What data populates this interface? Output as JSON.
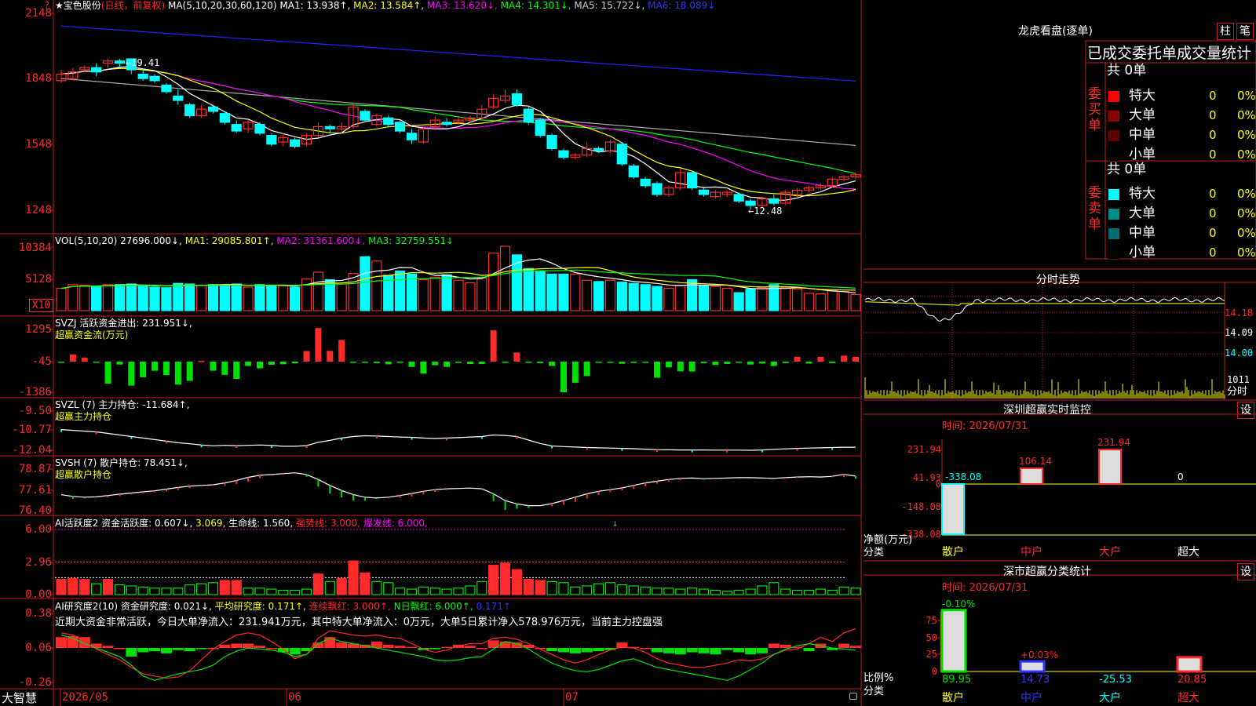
{
  "colors": {
    "up": "#ff2a2a",
    "down": "#00ffff",
    "grid": "#c81e1e",
    "ma1": "#ffffff",
    "ma2": "#ffff00",
    "ma3": "#ff00ff",
    "ma4": "#00ff00",
    "ma5": "#aaaaaa",
    "ma6": "#2323ff",
    "green": "#00e000",
    "yellow": "#ffff00",
    "magenta": "#ff00ff"
  },
  "price_panel": {
    "title": "★宝色股份",
    "period": "(日线，前复权)",
    "ma_prefix": "MA(5,10,20,30,60,120)",
    "mas": [
      {
        "label": "MA1: 13.938↑,",
        "key": "ma1"
      },
      {
        "label": "MA2: 13.584↑,",
        "key": "ma2"
      },
      {
        "label": "MA3: 13.620↓,",
        "key": "ma3"
      },
      {
        "label": "MA4: 14.301↓,",
        "key": "ma4"
      },
      {
        "label": "MA5: 15.722↓,",
        "key": "ma5"
      },
      {
        "label": "MA6: 18.089↓",
        "key": "ma6"
      }
    ],
    "y_labels": [
      "2148",
      "1848",
      "1548",
      "1248"
    ],
    "high_note": "←19.41",
    "low_note": "←12.48",
    "question_mark": "?"
  },
  "candles": [
    [
      18.4,
      18.7,
      18.3,
      18.9
    ],
    [
      18.5,
      18.8,
      18.4,
      19.0
    ],
    [
      18.9,
      19.0,
      18.8,
      19.1
    ],
    [
      19.0,
      18.8,
      18.6,
      19.2
    ],
    [
      19.2,
      19.3,
      19.0,
      19.4
    ],
    [
      19.3,
      19.2,
      19.0,
      19.4
    ],
    [
      19.4,
      18.9,
      18.7,
      19.41
    ],
    [
      18.7,
      18.5,
      18.4,
      18.9
    ],
    [
      18.6,
      18.4,
      18.3,
      18.7
    ],
    [
      18.2,
      17.9,
      17.8,
      18.3
    ],
    [
      17.7,
      17.5,
      17.3,
      18.0
    ],
    [
      17.3,
      16.8,
      16.7,
      17.4
    ],
    [
      16.8,
      17.1,
      16.7,
      17.3
    ],
    [
      17.2,
      17.0,
      16.9,
      17.3
    ],
    [
      16.9,
      16.5,
      16.4,
      17.0
    ],
    [
      16.4,
      16.1,
      16.0,
      16.6
    ],
    [
      16.2,
      16.5,
      16.0,
      16.6
    ],
    [
      16.4,
      16.0,
      15.9,
      16.5
    ],
    [
      15.9,
      15.5,
      15.4,
      16.0
    ],
    [
      15.6,
      15.8,
      15.4,
      16.0
    ],
    [
      15.7,
      15.4,
      15.3,
      15.8
    ],
    [
      15.5,
      15.9,
      15.4,
      16.0
    ],
    [
      15.9,
      16.3,
      15.8,
      16.5
    ],
    [
      16.3,
      16.2,
      16.0,
      16.4
    ],
    [
      16.2,
      16.3,
      16.0,
      16.5
    ],
    [
      16.3,
      17.2,
      16.2,
      17.3
    ],
    [
      17.0,
      16.6,
      16.5,
      17.1
    ],
    [
      16.4,
      16.8,
      16.3,
      16.9
    ],
    [
      16.7,
      16.4,
      16.3,
      16.8
    ],
    [
      16.5,
      16.1,
      16.0,
      16.6
    ],
    [
      16.0,
      15.7,
      15.5,
      16.2
    ],
    [
      15.6,
      16.2,
      15.5,
      16.3
    ],
    [
      16.3,
      16.6,
      16.2,
      16.8
    ],
    [
      16.5,
      16.4,
      16.3,
      16.7
    ],
    [
      16.5,
      16.6,
      16.4,
      16.8
    ],
    [
      16.6,
      16.7,
      16.5,
      16.8
    ],
    [
      16.7,
      17.1,
      16.6,
      17.3
    ],
    [
      17.2,
      17.6,
      17.1,
      17.8
    ],
    [
      17.5,
      17.7,
      17.4,
      18.0
    ],
    [
      17.8,
      17.3,
      17.2,
      18.0
    ],
    [
      17.1,
      16.5,
      16.4,
      17.2
    ],
    [
      16.6,
      15.9,
      15.8,
      16.7
    ],
    [
      15.9,
      15.3,
      15.2,
      16.0
    ],
    [
      15.2,
      14.9,
      14.8,
      15.3
    ],
    [
      14.9,
      15.0,
      14.8,
      15.1
    ],
    [
      15.0,
      15.3,
      14.9,
      15.6
    ],
    [
      15.3,
      15.2,
      15.1,
      15.4
    ],
    [
      15.2,
      15.6,
      15.1,
      15.7
    ],
    [
      15.5,
      14.6,
      14.5,
      15.6
    ],
    [
      14.5,
      14.0,
      13.9,
      14.6
    ],
    [
      13.9,
      13.6,
      13.5,
      14.0
    ],
    [
      13.7,
      13.2,
      13.1,
      13.8
    ],
    [
      13.2,
      13.5,
      13.1,
      13.6
    ],
    [
      13.5,
      14.2,
      13.4,
      14.4
    ],
    [
      14.2,
      13.5,
      13.4,
      14.3
    ],
    [
      13.4,
      13.2,
      13.1,
      13.5
    ],
    [
      13.1,
      13.3,
      13.0,
      13.4
    ],
    [
      13.2,
      13.3,
      13.1,
      13.4
    ],
    [
      13.2,
      12.9,
      12.8,
      13.3
    ],
    [
      12.9,
      12.7,
      12.5,
      13.0
    ],
    [
      12.7,
      13.0,
      12.6,
      13.1
    ],
    [
      13.0,
      12.8,
      12.7,
      13.2
    ],
    [
      12.8,
      13.3,
      12.7,
      13.4
    ],
    [
      13.2,
      13.4,
      13.1,
      13.5
    ],
    [
      13.4,
      13.5,
      13.3,
      13.6
    ],
    [
      13.5,
      13.6,
      13.4,
      13.7
    ],
    [
      13.6,
      13.9,
      13.5,
      14.0
    ],
    [
      13.9,
      14.0,
      13.8,
      14.1
    ],
    [
      14.0,
      14.1,
      13.9,
      14.2
    ]
  ],
  "vol_panel": {
    "label": "VOL(5,10,20)",
    "value": "27696.000↓,",
    "ma1": "MA1: 29085.801↑,",
    "ma2": "MA2: 31361.600↓,",
    "ma3": "MA3: 32759.551↓",
    "y_labels": [
      "10384",
      "5128"
    ],
    "unit": "X10"
  },
  "volumes": [
    3600,
    4200,
    4100,
    4000,
    4200,
    4200,
    4300,
    4000,
    3800,
    3700,
    4400,
    4300,
    4100,
    4200,
    4100,
    4300,
    3800,
    4200,
    4000,
    4000,
    3800,
    5100,
    6200,
    5000,
    4300,
    6000,
    8700,
    8000,
    5700,
    6400,
    5900,
    5000,
    5400,
    5800,
    4900,
    4500,
    5300,
    9300,
    10384,
    9000,
    6800,
    6300,
    5900,
    5900,
    5900,
    4900,
    4700,
    4900,
    4600,
    4400,
    4200,
    3900,
    3600,
    4100,
    5000,
    4000,
    3900,
    3600,
    2900,
    3500,
    3700,
    4200,
    3700,
    3500,
    2800,
    2700,
    3200,
    3100,
    2600
  ],
  "svzj_panel": {
    "label": "SVZJ  活跃资金进出: 231.951↓,",
    "sub": "超赢资金流(万元)",
    "y_labels": [
      "1295",
      "-45",
      "-1386"
    ]
  },
  "svzj_bars": [
    -40,
    300,
    160,
    -30,
    -920,
    -120,
    -1000,
    -650,
    -380,
    -560,
    -960,
    -800,
    30,
    -380,
    -550,
    -720,
    -180,
    -280,
    -130,
    -110,
    -70,
    440,
    1400,
    450,
    900,
    -30,
    -20,
    -60,
    -110,
    -50,
    -220,
    -500,
    -150,
    -220,
    -50,
    -100,
    -100,
    1300,
    -10,
    380,
    -30,
    -60,
    -180,
    -1280,
    -880,
    -600,
    -40,
    -30,
    -90,
    -20,
    -10,
    -670,
    -240,
    -400,
    -410,
    -60,
    -140,
    -100,
    -30,
    -120,
    -80,
    -180,
    -60,
    200,
    -80,
    200,
    -60,
    250,
    200
  ],
  "svzl_panel": {
    "label": "SVZL (7) 主力持仓: -11.684↑,",
    "sub": "超赢主力持仓",
    "y_labels": [
      "-9.50",
      "-10.77",
      "-12.04"
    ]
  },
  "svzl_line": [
    -10.7,
    -10.75,
    -10.8,
    -10.85,
    -10.95,
    -11.05,
    -11.15,
    -11.25,
    -11.35,
    -11.45,
    -11.55,
    -11.62,
    -11.7,
    -11.75,
    -11.72,
    -11.74,
    -11.72,
    -11.7,
    -11.73,
    -11.78,
    -11.78,
    -11.74,
    -11.52,
    -11.4,
    -11.25,
    -11.15,
    -11.1,
    -11.12,
    -11.15,
    -11.18,
    -11.2,
    -11.25,
    -11.28,
    -11.25,
    -11.22,
    -11.18,
    -11.15,
    -11.05,
    -11.08,
    -11.15,
    -11.38,
    -11.6,
    -11.76,
    -11.8,
    -11.83,
    -11.86,
    -11.88,
    -11.9,
    -11.92,
    -11.94,
    -11.97,
    -12.0,
    -12.01,
    -12.02,
    -12.02,
    -12.02,
    -12.03,
    -12.03,
    -12.03,
    -12.04,
    -12.02,
    -11.98,
    -11.95,
    -11.92,
    -11.9,
    -11.88,
    -11.86,
    -11.84,
    -11.84
  ],
  "svsh_panel": {
    "label": "SVSH (7) 散户持仓: 78.451↓,",
    "sub": "超赢散户持仓",
    "y_labels": [
      "78.87",
      "77.61",
      "76.40"
    ]
  },
  "svsh_line": [
    77.35,
    77.25,
    77.2,
    77.22,
    77.3,
    77.38,
    77.45,
    77.52,
    77.58,
    77.68,
    77.78,
    77.86,
    77.9,
    77.94,
    78.05,
    78.2,
    78.38,
    78.5,
    78.55,
    78.6,
    78.65,
    78.55,
    78.25,
    77.9,
    77.6,
    77.35,
    77.2,
    77.15,
    77.2,
    77.3,
    77.42,
    77.55,
    77.65,
    77.7,
    77.72,
    77.74,
    77.7,
    77.4,
    77.0,
    76.8,
    76.7,
    76.7,
    76.82,
    77.0,
    77.2,
    77.4,
    77.55,
    77.65,
    77.75,
    77.9,
    78.05,
    78.15,
    78.25,
    78.32,
    78.34,
    78.3,
    78.32,
    78.34,
    78.36,
    78.36,
    78.34,
    78.32,
    78.36,
    78.4,
    78.42,
    78.4,
    78.44,
    78.56,
    78.45
  ],
  "ai_active_panel": {
    "label_a": "AI活跃度2 资金活跃度: 0.607↓,",
    "label_b": "3.069,",
    "label_c": "生命线: 1.560,",
    "label_d": "强势线: 3.000,",
    "label_e": "爆发线: 6.000,",
    "y_labels": [
      "6.00",
      "2.96",
      "0.00"
    ],
    "arrow": "↓"
  },
  "ai_active_bars": [
    1.4,
    1.5,
    1.4,
    1.0,
    1.4,
    0.9,
    0.8,
    0.7,
    0.6,
    0.6,
    0.6,
    0.9,
    1.0,
    1.1,
    1.3,
    1.3,
    0.6,
    0.6,
    0.5,
    0.4,
    0.4,
    0.5,
    1.9,
    1.2,
    1.5,
    3.1,
    2.0,
    1.2,
    1.1,
    0.6,
    0.5,
    0.7,
    0.6,
    0.5,
    0.6,
    0.8,
    1.2,
    2.7,
    2.9,
    2.3,
    1.4,
    1.3,
    1.2,
    1.1,
    0.7,
    0.8,
    1.0,
    1.1,
    0.9,
    0.8,
    0.7,
    0.6,
    0.6,
    0.5,
    0.6,
    0.5,
    0.4,
    0.3,
    0.4,
    0.5,
    0.8,
    1.1,
    0.5,
    0.4,
    0.4,
    0.5,
    0.4,
    0.7,
    0.6
  ],
  "ai_research_panel": {
    "label_a": "AI研究度2(10) 资金研究度: 0.021↓,",
    "label_b": "平均研究度: 0.171↑,",
    "label_c": "连续飘红: 3.000↑,",
    "label_d": "N日飘红: 6.000↑,",
    "label_e": "0.171↑",
    "comment": "近期大资金非常活跃，今日大单净流入：231.941万元，其中特大单净流入：0万元，大单5日累计净入578.976万元，当前主力控盘强",
    "y_labels": [
      "0.38",
      "0.06",
      "-0.26"
    ]
  },
  "ai_research_bars": [
    0.1,
    0.11,
    0.1,
    0.04,
    0.02,
    0.0,
    -0.08,
    -0.04,
    -0.03,
    -0.05,
    -0.02,
    -0.03,
    -0.01,
    0.0,
    0.03,
    0.04,
    0.04,
    0.02,
    0.0,
    -0.04,
    -0.06,
    -0.03,
    0.05,
    0.1,
    0.05,
    0.04,
    0.03,
    0.06,
    0.03,
    0.02,
    0.01,
    -0.02,
    -0.01,
    0.01,
    0.03,
    0.02,
    0.0,
    0.07,
    0.06,
    0.05,
    0.03,
    0.0,
    -0.03,
    -0.04,
    -0.05,
    -0.04,
    -0.03,
    -0.02,
    0.05,
    0.01,
    0.0,
    -0.04,
    -0.05,
    -0.06,
    -0.04,
    -0.05,
    -0.06,
    -0.02,
    -0.04,
    -0.06,
    -0.05,
    0.04,
    0.03,
    0.01,
    -0.03,
    0.04,
    -0.02,
    0.04,
    0.02
  ],
  "ai_research_red_line": [
    0.2,
    0.18,
    0.12,
    0.05,
    0.0,
    -0.05,
    -0.12,
    -0.18,
    -0.2,
    -0.22,
    -0.21,
    -0.15,
    -0.05,
    0.05,
    0.12,
    0.18,
    0.2,
    0.18,
    0.12,
    0.05,
    -0.04,
    0.0,
    0.15,
    0.22,
    0.2,
    0.18,
    0.17,
    0.18,
    0.16,
    0.15,
    0.1,
    0.05,
    0.02,
    0.04,
    0.08,
    0.1,
    0.1,
    0.15,
    0.16,
    0.14,
    0.1,
    0.05,
    0.0,
    -0.05,
    -0.08,
    -0.05,
    0.0,
    0.04,
    0.07,
    0.06,
    0.02,
    -0.04,
    -0.08,
    -0.1,
    -0.12,
    -0.12,
    -0.1,
    -0.08,
    -0.05,
    -0.06,
    -0.04,
    0.0,
    0.04,
    0.05,
    0.1,
    0.16,
    0.12,
    0.2,
    0.24
  ],
  "ai_research_green_line": [
    0.18,
    0.15,
    0.1,
    0.06,
    0.02,
    -0.02,
    -0.1,
    -0.2,
    -0.24,
    -0.21,
    -0.18,
    -0.16,
    -0.14,
    -0.1,
    -0.02,
    0.03,
    0.06,
    0.05,
    0.04,
    0.02,
    -0.02,
    0.0,
    0.1,
    0.15,
    0.12,
    0.1,
    0.08,
    0.06,
    0.04,
    0.02,
    0.0,
    -0.02,
    -0.05,
    -0.06,
    -0.05,
    -0.03,
    -0.02,
    0.05,
    0.12,
    0.1,
    0.05,
    -0.02,
    -0.08,
    -0.12,
    -0.15,
    -0.16,
    -0.14,
    -0.1,
    -0.06,
    -0.04,
    -0.08,
    -0.12,
    -0.14,
    -0.16,
    -0.18,
    -0.2,
    -0.22,
    -0.24,
    -0.2,
    -0.14,
    -0.08,
    0.0,
    0.05,
    0.08,
    0.1,
    0.08,
    0.06,
    0.05,
    0.04
  ],
  "date_axis": {
    "left_tag": "大智慧",
    "labels": [
      "2026/05",
      "06",
      "07"
    ]
  },
  "dragon_tiger": {
    "title": "龙虎看盘(逐单)",
    "btn_bar": "柱",
    "btn_pen": "笔",
    "heading": "已成交委托单成交量统计",
    "buy": {
      "side": "委买单",
      "total": "共 0单",
      "rows": [
        {
          "name": "特大",
          "count": "0",
          "pct": "0%",
          "color": "#ff0000"
        },
        {
          "name": "大单",
          "count": "0",
          "pct": "0%",
          "color": "#8b0000"
        },
        {
          "name": "中单",
          "count": "0",
          "pct": "0%",
          "color": "#600000"
        },
        {
          "name": "小单",
          "count": "0",
          "pct": "0%",
          "color": "#000000"
        }
      ]
    },
    "sell": {
      "side": "委卖单",
      "total": "共 0单",
      "rows": [
        {
          "name": "特大",
          "count": "0",
          "pct": "0%",
          "color": "#00ffff"
        },
        {
          "name": "大单",
          "count": "0",
          "pct": "0%",
          "color": "#008b8b"
        },
        {
          "name": "中单",
          "count": "0",
          "pct": "0%",
          "color": "#006f6f"
        },
        {
          "name": "小单",
          "count": "0",
          "pct": "0%",
          "color": "#000000"
        }
      ]
    }
  },
  "intraday": {
    "title": "分时走势",
    "y_labels": [
      "14.18",
      "14.09",
      "14.00"
    ],
    "vol_label": "1011",
    "vol_tag": "分时"
  },
  "sz_monitor": {
    "title": "深圳超赢实时监控",
    "btn": "设",
    "time": "时间: 2026/07/31",
    "y_labels": [
      "231.94",
      "41.93",
      "0",
      "-148.08",
      "-338.08"
    ],
    "unit_a": "净额(万元)",
    "unit_b": "分类",
    "categories": [
      "散户",
      "中户",
      "大户",
      "超大"
    ],
    "values": [
      -338.08,
      106.14,
      231.94,
      0
    ],
    "value_labels": [
      "-338.08",
      "106.14",
      "231.94",
      "0"
    ]
  },
  "sz_classify": {
    "title": "深市超赢分类统计",
    "btn": "设",
    "time": "时间: 2026/07/31",
    "y_labels": [
      "75",
      "50",
      "25",
      "0"
    ],
    "unit_a": "比例%",
    "unit_b": "分类",
    "categories": [
      "散户",
      "中户",
      "大户",
      "超大"
    ],
    "bars": [
      89.95,
      14.73,
      0,
      20.85
    ],
    "top_labels": [
      "-0.10%",
      "+0.03%",
      "",
      ""
    ],
    "bottom_labels": [
      "89.95",
      "14.73",
      "-25.53",
      "20.85"
    ]
  }
}
